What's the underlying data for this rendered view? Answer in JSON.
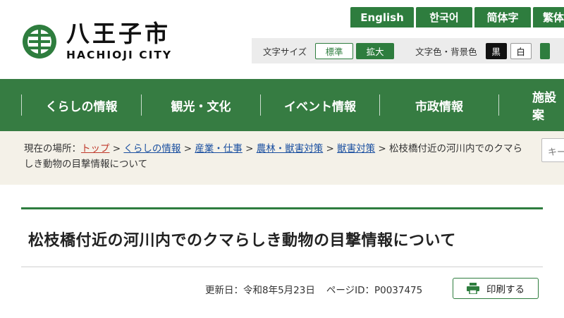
{
  "header": {
    "logo_jp": "八王子市",
    "logo_en": "HACHIOJI CITY",
    "languages": [
      "English",
      "한국어",
      "简体字",
      "繁体"
    ],
    "font_size_label": "文字サイズ",
    "font_size_standard": "標準",
    "font_size_large": "拡大",
    "color_label": "文字色・背景色",
    "color_black": "黒",
    "color_white": "白"
  },
  "nav": {
    "items": [
      "くらしの情報",
      "観光・文化",
      "イベント情報",
      "市政情報",
      "施設案"
    ]
  },
  "breadcrumb": {
    "prefix": "現在の場所：",
    "links": [
      "トップ",
      "くらしの情報",
      "産業・仕事",
      "農林・獣害対策",
      "獣害対策"
    ],
    "current": "松枝橋付近の河川内でのクマらしき動物の目撃情報について",
    "separator": ">"
  },
  "search": {
    "placeholder": "キー"
  },
  "page": {
    "title": "松枝橋付近の河川内でのクマらしき動物の目撃情報について",
    "updated": "更新日：令和8年5月23日",
    "page_id": "ページID：P0037475",
    "print_label": "印刷する"
  },
  "colors": {
    "brand_green": "#2e7d3e",
    "nav_green": "#367c42",
    "crumb_bg": "#f4f1e8"
  }
}
